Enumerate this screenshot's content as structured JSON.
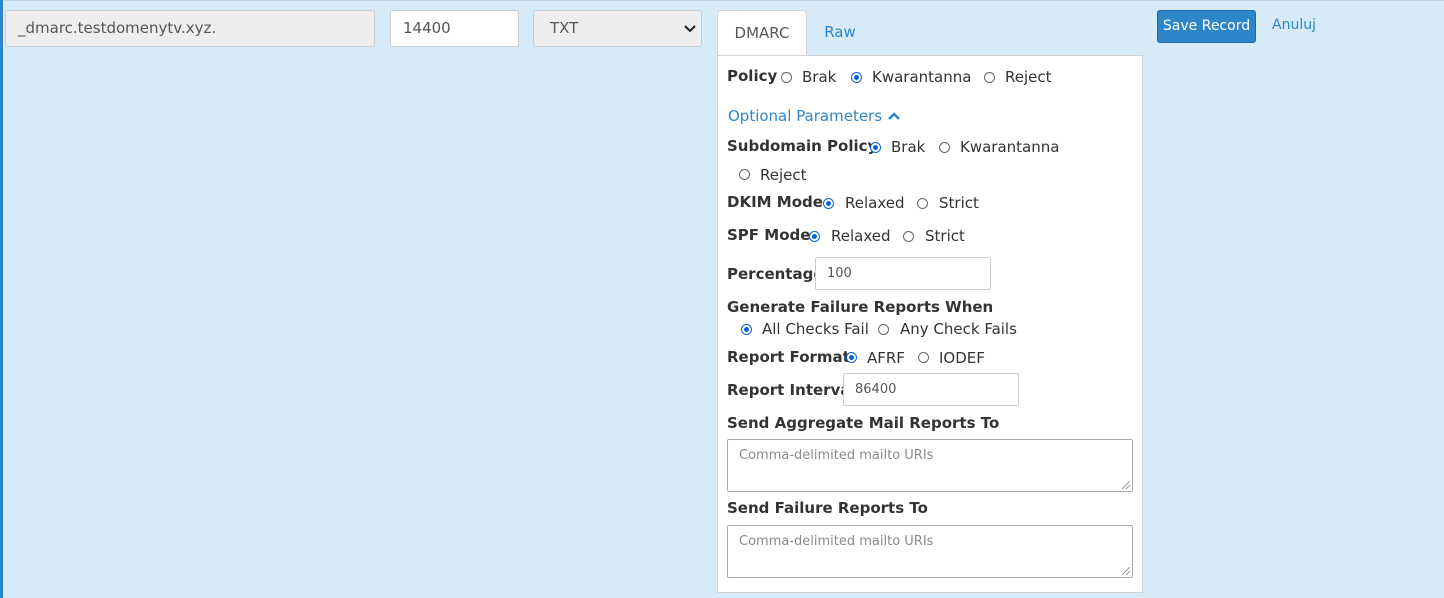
{
  "record": {
    "name": "_dmarc.testdomenytv.xyz.",
    "ttl": "14400",
    "type": "TXT"
  },
  "tabs": [
    {
      "label": "DMARC",
      "active": true
    },
    {
      "label": "Raw",
      "active": false
    }
  ],
  "dmarc": {
    "policy": {
      "label": "Policy",
      "options": [
        "Brak",
        "Kwarantanna",
        "Reject"
      ],
      "selected": "Kwarantanna"
    },
    "optional_toggle": "Optional Parameters",
    "subdomain_policy": {
      "label": "Subdomain Policy",
      "options": [
        "Brak",
        "Kwarantanna",
        "Reject"
      ],
      "selected": "Brak"
    },
    "dkim_mode": {
      "label": "DKIM Mode",
      "options": [
        "Relaxed",
        "Strict"
      ],
      "selected": "Relaxed"
    },
    "spf_mode": {
      "label": "SPF Mode",
      "options": [
        "Relaxed",
        "Strict"
      ],
      "selected": "Relaxed"
    },
    "percentage": {
      "label": "Percentage",
      "value": "100"
    },
    "failure_reports_when": {
      "label": "Generate Failure Reports When",
      "options": [
        "All Checks Fail",
        "Any Check Fails"
      ],
      "selected": "All Checks Fail"
    },
    "report_format": {
      "label": "Report Format",
      "options": [
        "AFRF",
        "IODEF"
      ],
      "selected": "AFRF"
    },
    "report_interval": {
      "label": "Report Interval",
      "value": "86400"
    },
    "aggregate_reports": {
      "label": "Send Aggregate Mail Reports To",
      "placeholder": "Comma-delimited mailto URIs"
    },
    "failure_reports": {
      "label": "Send Failure Reports To",
      "placeholder": "Comma-delimited mailto URIs"
    }
  },
  "actions": {
    "save_label": "Save Record",
    "cancel_label": "Anuluj"
  },
  "colors": {
    "background": "#d6eaf8",
    "accent": "#2e86c9",
    "radio_selected": "#0a63d6"
  },
  "icons": {
    "select_chevron": "chevron-down-icon",
    "optional_caret": "chevron-up-icon"
  }
}
